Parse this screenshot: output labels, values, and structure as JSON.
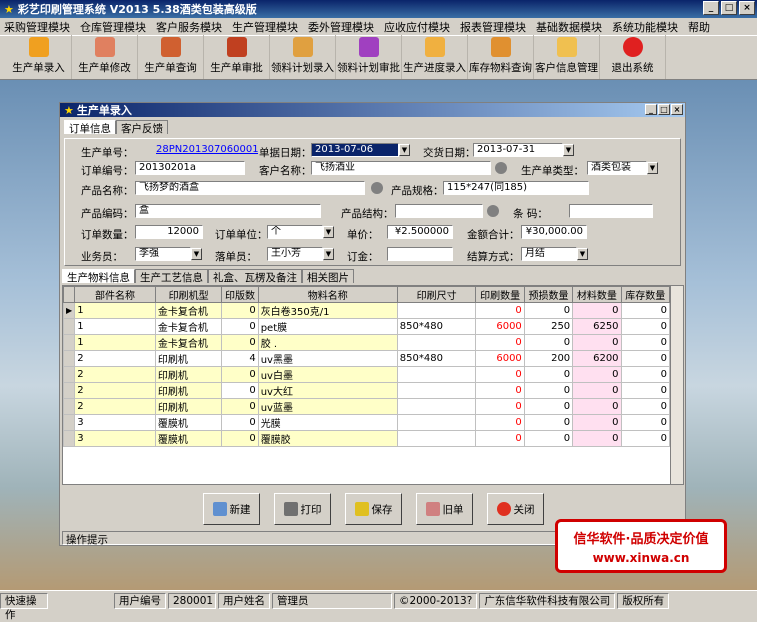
{
  "app_title": "彩艺印刷管理系统  V2013 5.38酒类包装高级版",
  "menu": [
    "采购管理模块",
    "仓库管理模块",
    "客户服务模块",
    "生产管理模块",
    "委外管理模块",
    "应收应付模块",
    "报表管理模块",
    "基础数据模块",
    "系统功能模块",
    "帮助"
  ],
  "toolbar": [
    "生产单录入",
    "生产单修改",
    "生产单查询",
    "生产单审批",
    "领料计划录入",
    "领料计划审批",
    "生产进度录入",
    "库存物料查询",
    "客户信息管理",
    "退出系统"
  ],
  "window_title": "生产单录入",
  "tabs": [
    "订单信息",
    "客户反馈"
  ],
  "form": {
    "l_order_no": "生产单号：",
    "order_no": "28PN201307060001",
    "l_doc_date": "单据日期：",
    "doc_date": "2013-07-06",
    "l_delivery": "交货日期：",
    "delivery": "2013-07-31",
    "l_order_code": "订单编号：",
    "order_code": "20130201a",
    "l_customer": "客户名称：",
    "customer": "飞扬酒业",
    "l_type": "生产单类型：",
    "type": "酒类包装",
    "l_product": "产品名称：",
    "product": "飞扬梦酌酒盒",
    "l_spec": "产品规格：",
    "spec": "115*247(同185)",
    "l_pcode": "产品编码：",
    "pcode": "盒",
    "l_struct": "产品结构：",
    "struct": "",
    "l_barcode": "条  码：",
    "barcode": "",
    "l_qty": "订单数量：",
    "qty": "12000",
    "l_unit": "订单单位：",
    "unit": "个",
    "l_price": "单价：",
    "price": "¥2.500000",
    "l_total": "金额合计：",
    "total": "¥30,000.00",
    "l_sales": "业务员：",
    "sales": "李强",
    "l_issuer": "落单员：",
    "issuer": "王小芳",
    "l_deposit": "订金：",
    "deposit": "",
    "l_settle": "结算方式：",
    "settle": "月结"
  },
  "tabs2": [
    "生产物料信息",
    "生产工艺信息",
    "礼盒、瓦楞及备注",
    "相关图片"
  ],
  "table": {
    "headers": [
      "部件名称",
      "印刷机型",
      "印版数",
      "物料名称",
      "印刷尺寸",
      "印刷数量",
      "预损数量",
      "材料数量",
      "库存数量"
    ],
    "rows": [
      [
        "1",
        "金卡复合机",
        "0",
        "灰白卷350克/1",
        "",
        "0",
        "0",
        "0",
        "0"
      ],
      [
        "1",
        "金卡复合机",
        "0",
        "pet膜",
        "850*480",
        "6000",
        "250",
        "6250",
        "0"
      ],
      [
        "1",
        "金卡复合机",
        "0",
        "胶  .",
        "",
        "0",
        "0",
        "0",
        "0"
      ],
      [
        "2",
        "印刷机",
        "4",
        "uv黑墨",
        "850*480",
        "6000",
        "200",
        "6200",
        "0"
      ],
      [
        "2",
        "印刷机",
        "0",
        "uv白墨",
        "",
        "0",
        "0",
        "0",
        "0"
      ],
      [
        "2",
        "印刷机",
        "0",
        "uv大红",
        "",
        "0",
        "0",
        "0",
        "0"
      ],
      [
        "2",
        "印刷机",
        "0",
        "uv蓝墨",
        "",
        "0",
        "0",
        "0",
        "0"
      ],
      [
        "3",
        "覆膜机",
        "0",
        "光膜",
        "",
        "0",
        "0",
        "0",
        "0"
      ],
      [
        "3",
        "覆膜机",
        "0",
        "覆膜胶",
        "",
        "0",
        "0",
        "0",
        "0"
      ]
    ]
  },
  "buttons": [
    "新建",
    "打印",
    "保存",
    "旧单",
    "关闭"
  ],
  "hint": "操作提示",
  "promo": {
    "line1": "信华软件·品质决定价值",
    "line2": "www.xinwa.cn"
  },
  "status": [
    "快速操作",
    "用户编号",
    "280001",
    "用户姓名",
    "管理员",
    "©2000-2013?",
    "广东信华软件科技有限公司",
    "版权所有"
  ]
}
